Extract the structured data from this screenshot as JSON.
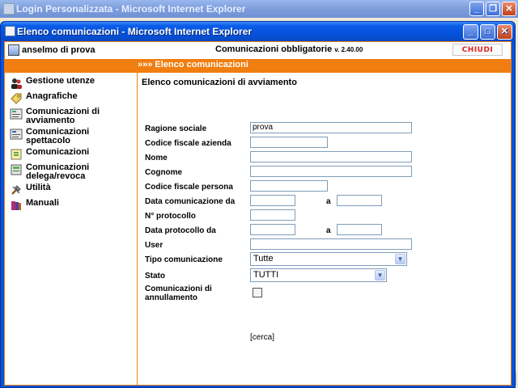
{
  "background_window": {
    "title": "Login Personalizzata - Microsoft Internet Explorer"
  },
  "window": {
    "title": "Elenco comunicazioni - Microsoft Internet Explorer"
  },
  "header": {
    "user_name": "anselmo di prova",
    "app_title": "Comunicazioni obbligatorie",
    "app_version": "v. 2.40.00",
    "close_label": "CHIUDI"
  },
  "breadcrumb": "»»» Elenco comunicazioni",
  "sidebar": {
    "items": [
      {
        "label": "Gestione utenze",
        "icon": "users-icon"
      },
      {
        "label": "Anagrafiche",
        "icon": "tag-icon"
      },
      {
        "label": "Comunicazioni di avviamento",
        "icon": "form-icon"
      },
      {
        "label": "Comunicazioni spettacolo",
        "icon": "form-icon"
      },
      {
        "label": "Comunicazioni",
        "icon": "notebook-icon"
      },
      {
        "label": "Comunicazioni delega/revoca",
        "icon": "document-icon"
      },
      {
        "label": "Utilità",
        "icon": "tools-icon"
      },
      {
        "label": "Manuali",
        "icon": "books-icon"
      }
    ]
  },
  "main": {
    "title": "Elenco comunicazioni di avviamento",
    "labels": {
      "ragione_sociale": "Ragione sociale",
      "codice_fiscale_azienda": "Codice fiscale azienda",
      "nome": "Nome",
      "cognome": "Cognome",
      "codice_fiscale_persona": "Codice fiscale persona",
      "data_comunicazione_da": "Data comunicazione da",
      "a": "a",
      "numero_protocollo": "N° protocollo",
      "data_protocollo_da": "Data protocollo da",
      "user": "User",
      "tipo_comunicazione": "Tipo comunicazione",
      "stato": "Stato",
      "comunicazioni_annullamento": "Comunicazioni di annullamento"
    },
    "values": {
      "ragione_sociale": "prova",
      "tipo_comunicazione": "Tutte",
      "stato": "TUTTI"
    },
    "search_label": "[cerca]"
  }
}
